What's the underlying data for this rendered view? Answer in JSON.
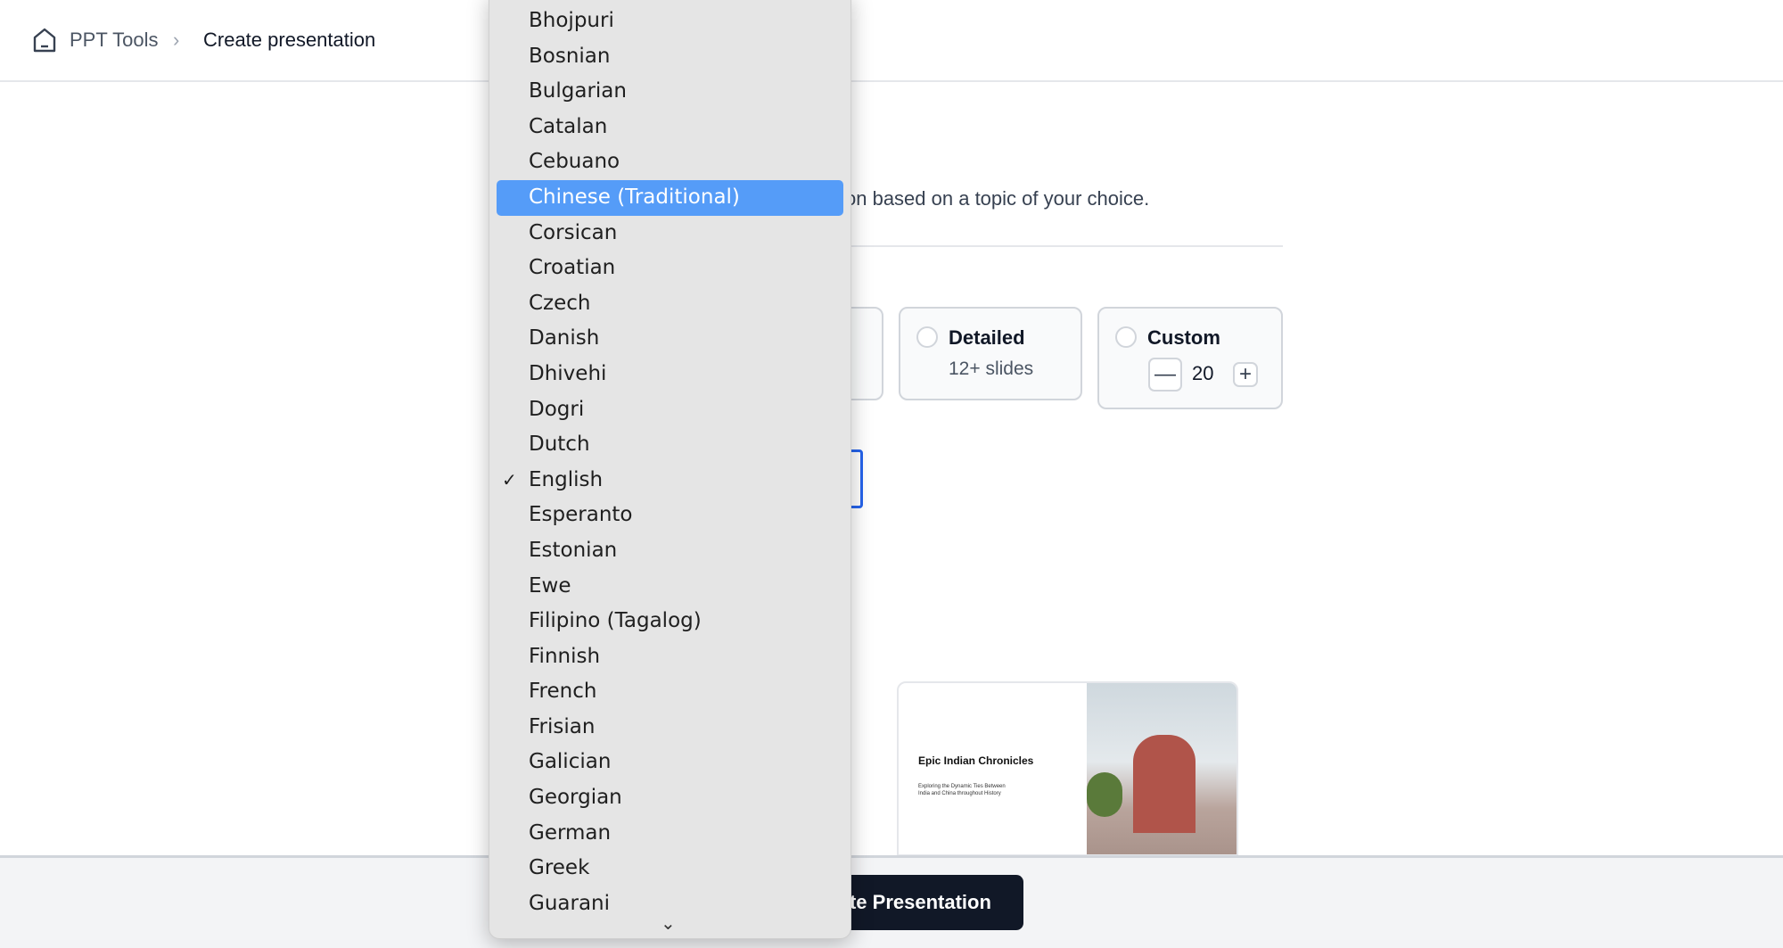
{
  "breadcrumb": {
    "home": "PPT Tools",
    "separator": "›",
    "current": "Create presentation"
  },
  "page": {
    "subtitle_fragment": "on based on a topic of your choice."
  },
  "length_options": [
    {
      "label": "Detailed",
      "sub": "12+ slides",
      "selected": false
    },
    {
      "label": "Custom",
      "value": "20",
      "minus": "—",
      "plus": "+",
      "selected": false
    }
  ],
  "template": {
    "title": "Epic Indian Chronicles",
    "subtitle": "Exploring the Dynamic Ties Between India and China throughout History"
  },
  "footer": {
    "create_label": "Create Presentation"
  },
  "language_menu": {
    "selected": "English",
    "highlighted": "Chinese (Traditional)",
    "items": [
      "Bhojpuri",
      "Bosnian",
      "Bulgarian",
      "Catalan",
      "Cebuano",
      "Chinese (Traditional)",
      "Corsican",
      "Croatian",
      "Czech",
      "Danish",
      "Dhivehi",
      "Dogri",
      "Dutch",
      "English",
      "Esperanto",
      "Estonian",
      "Ewe",
      "Filipino (Tagalog)",
      "Finnish",
      "French",
      "Frisian",
      "Galician",
      "Georgian",
      "German",
      "Greek",
      "Guarani"
    ],
    "check": "✓",
    "scroll_icon": "chevron-down-icon"
  },
  "colors": {
    "accent": "#2563eb",
    "highlight": "#559cf8",
    "button": "#111827"
  }
}
